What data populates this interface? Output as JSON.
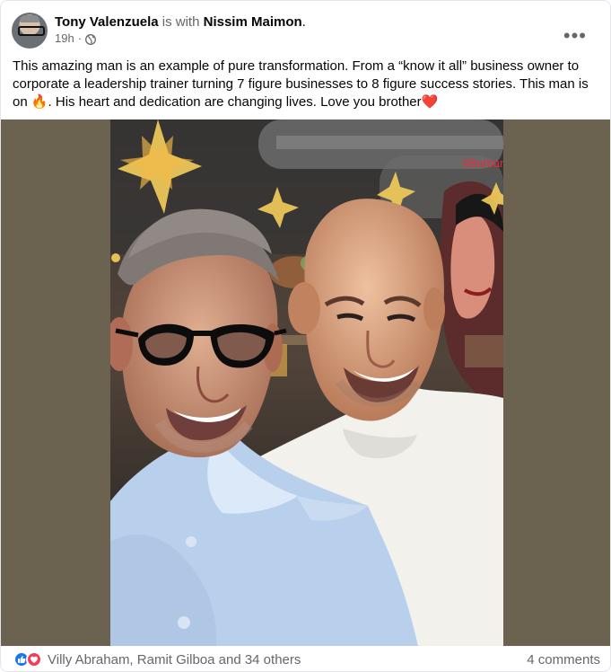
{
  "post": {
    "author": "Tony Valenzuela",
    "with_text": "is with",
    "tagged": "Nissim Maimon",
    "period": ".",
    "time": "19h",
    "audience_icon": "globe-icon",
    "more_icon": "more-options-icon",
    "more_label": "•••",
    "text_part1": "This amazing man is an example of pure transformation. From a “know it all” business owner to corporate a leadership trainer turning 7 figure businesses to 8 figure success stories. This man is on ",
    "emoji_fire": "🔥",
    "text_part2": ".  His heart and dedication are changing lives. Love you brother",
    "emoji_heart": "❤️"
  },
  "photo": {
    "sign_text": "#Burbank"
  },
  "footer": {
    "reaction_icons": [
      "like-icon",
      "love-icon"
    ],
    "reactions_text": "Villy Abraham, Ramit Gilboa and 34 others",
    "comments_text": "4 comments"
  },
  "colors": {
    "facebook_blue": "#1877f2",
    "love_red": "#f33e58",
    "muted_text": "#65676b",
    "photo_letterbox": "#6b6350",
    "sign_red": "#e82a3d"
  }
}
